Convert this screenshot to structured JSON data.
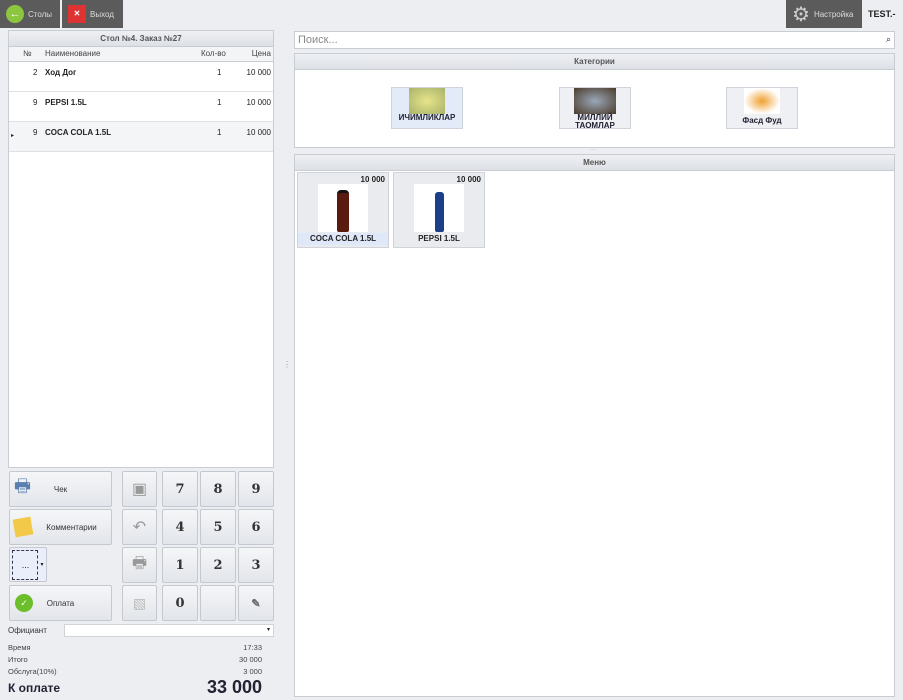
{
  "topbar": {
    "tables_label": "Столы",
    "exit_label": "Выход",
    "settings_label": "Настройка",
    "user": "TEST.-"
  },
  "order": {
    "title": "Стол №4. Заказ №27",
    "columns": [
      "№",
      "Наименование",
      "Кол-во",
      "Цена"
    ],
    "rows": [
      {
        "no": "2",
        "name": "Ход Дог",
        "qty": "1",
        "price": "10 000"
      },
      {
        "no": "9",
        "name": "PEPSI 1.5L",
        "qty": "1",
        "price": "10 000"
      },
      {
        "no": "9",
        "name": "COCA COLA 1.5L",
        "qty": "1",
        "price": "10 000"
      }
    ]
  },
  "actions": {
    "check": "Чек",
    "comments": "Комментарии",
    "more": "...",
    "pay": "Оплата"
  },
  "numpad": [
    "7",
    "8",
    "9",
    "4",
    "5",
    "6",
    "1",
    "2",
    "3",
    "0"
  ],
  "summary": {
    "waiter_label": "Официант",
    "waiter_value": "",
    "time_label": "Время",
    "time": "17:33",
    "total_label": "Итого",
    "total": "30 000",
    "service_label": "Обслуга(10%)",
    "service": "3 000",
    "due_label": "К оплате",
    "due": "33 000"
  },
  "search": {
    "placeholder": "Поиск..."
  },
  "categories": {
    "title": "Категории",
    "items": [
      {
        "name": "ИЧИМЛИКЛАР"
      },
      {
        "name": "МИЛЛИЙ ТАОМЛАР"
      },
      {
        "name": "Фасд Фуд"
      }
    ]
  },
  "menu": {
    "title": "Меню",
    "items": [
      {
        "name": "COCA COLA 1.5L",
        "price": "10 000"
      },
      {
        "name": "PEPSI 1.5L",
        "price": "10 000"
      }
    ]
  }
}
